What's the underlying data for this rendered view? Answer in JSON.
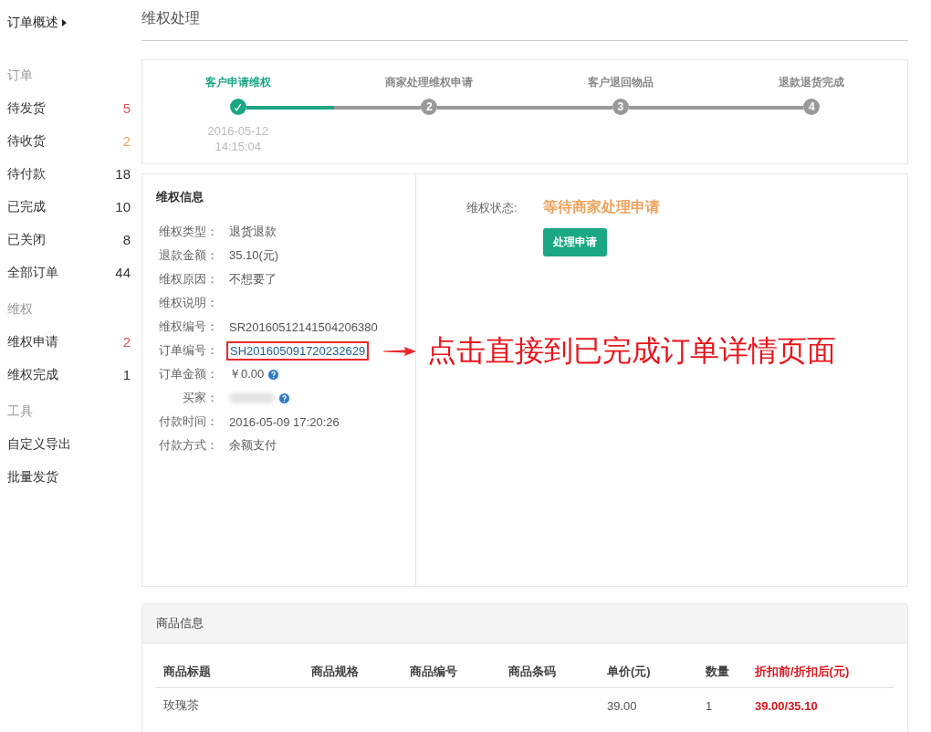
{
  "sidebar": {
    "overview": "订单概述",
    "groups": [
      {
        "title": "订单",
        "items": [
          {
            "label": "待发货",
            "count": "5",
            "color": "#e4525b"
          },
          {
            "label": "待收货",
            "count": "2",
            "color": "#f0a35c"
          },
          {
            "label": "待付款",
            "count": "18",
            "color": "#333333"
          },
          {
            "label": "已完成",
            "count": "10",
            "color": "#333333"
          },
          {
            "label": "已关闭",
            "count": "8",
            "color": "#333333"
          },
          {
            "label": "全部订单",
            "count": "44",
            "color": "#333333"
          }
        ]
      },
      {
        "title": "维权",
        "items": [
          {
            "label": "维权申请",
            "count": "2",
            "color": "#e4525b"
          },
          {
            "label": "维权完成",
            "count": "1",
            "color": "#333333"
          }
        ]
      },
      {
        "title": "工具",
        "items": [
          {
            "label": "自定义导出"
          },
          {
            "label": "批量发货"
          }
        ]
      }
    ]
  },
  "page_title": "维权处理",
  "steps": {
    "items": [
      {
        "label": "客户申请维权",
        "done": true,
        "date": "2016-05-12",
        "time": "14:15:04",
        "level": 0.5
      },
      {
        "label": "商家处理维权申请",
        "done": false,
        "number": "2"
      },
      {
        "label": "客户退回物品",
        "done": false,
        "number": "3"
      },
      {
        "label": "退款退货完成",
        "done": false,
        "number": "4"
      }
    ]
  },
  "info": {
    "title": "维权信息",
    "rows": [
      {
        "label": "维权类型：",
        "value": "退货退款"
      },
      {
        "label": "退款金额：",
        "value": "35.10(元)"
      },
      {
        "label": "维权原因：",
        "value": "不想要了"
      },
      {
        "label": "维权说明："
      },
      {
        "label": "维权编号：",
        "value": "SR20160512141504206380"
      },
      {
        "label": "订单编号：",
        "value": "SH201605091720232629",
        "link": true,
        "highlighted": true
      },
      {
        "label": "订单金额：",
        "value": "￥0.00",
        "help": true
      },
      {
        "label": "买家：",
        "blurred": true,
        "help": true
      },
      {
        "label": "付款时间：",
        "value": "2016-05-09 17:20:26"
      },
      {
        "label": "付款方式：",
        "value": "余额支付"
      }
    ]
  },
  "status": {
    "label": "维权状态:",
    "value": "等待商家处理申请",
    "button": "处理申请"
  },
  "annotation": "点击直接到已完成订单详情页面",
  "products": {
    "title": "商品信息",
    "columns": [
      {
        "label": "商品标题",
        "accent": false
      },
      {
        "label": "商品规格",
        "accent": false
      },
      {
        "label": "商品编号",
        "accent": false
      },
      {
        "label": "商品条码",
        "accent": false
      },
      {
        "label": "单价(元)",
        "accent": false
      },
      {
        "label": "数量",
        "accent": false
      },
      {
        "label": "折扣前/折扣后(元)",
        "accent": true
      }
    ],
    "rows": [
      [
        "玫瑰茶",
        "",
        "",
        "",
        "39.00",
        "1",
        "39.00/35.10"
      ]
    ]
  }
}
